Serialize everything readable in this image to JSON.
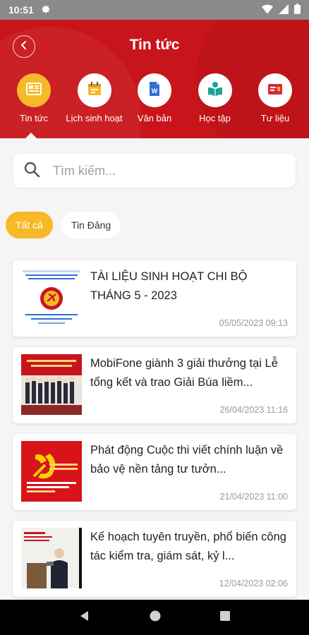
{
  "status": {
    "time": "10:51"
  },
  "header": {
    "title": "Tin tức"
  },
  "categories": [
    {
      "label": "Tin tức",
      "icon": "newspaper-icon",
      "active": true
    },
    {
      "label": "Lịch sinh hoạt",
      "icon": "calendar-icon",
      "active": false
    },
    {
      "label": "Văn bản",
      "icon": "word-document-icon",
      "active": false
    },
    {
      "label": "Học tập",
      "icon": "study-book-icon",
      "active": false
    },
    {
      "label": "Tư liệu",
      "icon": "archive-folder-icon",
      "active": false
    }
  ],
  "search": {
    "placeholder": "Tìm kiếm..."
  },
  "filters": [
    {
      "label": "Tất cả",
      "active": true
    },
    {
      "label": "Tin Đảng",
      "active": false
    }
  ],
  "articles": [
    {
      "title": "TÀI LIỆU SINH HOẠT CHI BỘ THÁNG 5 - 2023",
      "date": "05/05/2023 09:13"
    },
    {
      "title": "MobiFone giành 3 giải thưởng tại Lễ tổng kết và trao Giải Búa liềm...",
      "date": "26/04/2023 11:16"
    },
    {
      "title": "Phát động Cuộc thi viết chính luận về bảo vệ nền tảng tư tưởn...",
      "date": "21/04/2023 11:00"
    },
    {
      "title": "Kế hoạch tuyên truyền, phổ biến công tác kiểm tra,  giám sát, kỷ l...",
      "date": "12/04/2023 02:06"
    }
  ],
  "colors": {
    "primary_red": "#c8151b",
    "accent_yellow": "#f7b928"
  }
}
